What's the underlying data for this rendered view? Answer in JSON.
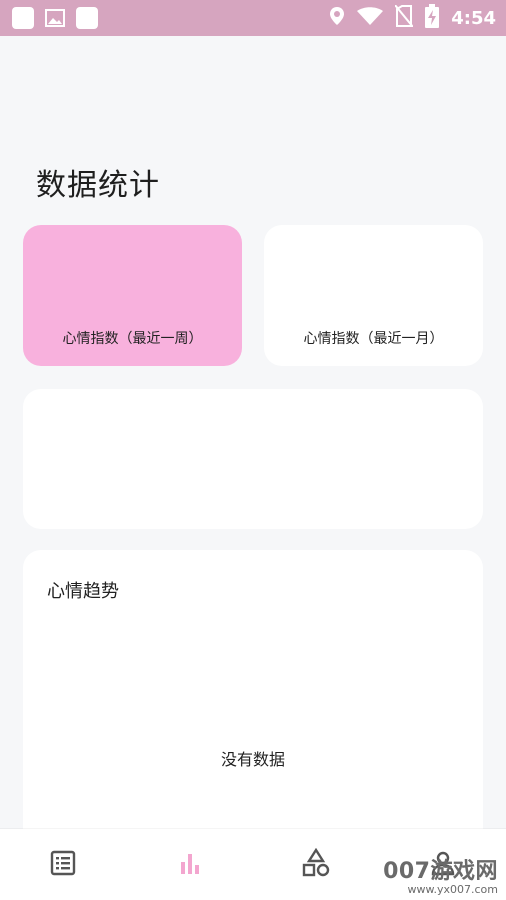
{
  "status_bar": {
    "time": "4:54",
    "icons_left": [
      "app-square-icon",
      "image-icon",
      "app-square-icon"
    ],
    "icons_right": [
      "location-icon",
      "wifi-icon",
      "no-sim-icon",
      "battery-charging-icon"
    ]
  },
  "page": {
    "title": "数据统计"
  },
  "cards": {
    "week_label": "心情指数（最近一周）",
    "month_label": "心情指数（最近一月）"
  },
  "trend": {
    "title": "心情趋势",
    "empty": "没有数据"
  },
  "nav": {
    "items": [
      "list-icon",
      "bar-chart-icon",
      "shapes-icon",
      "profile-icon"
    ],
    "active_color": "#f3a6cf"
  },
  "watermark": {
    "main": "007游戏网",
    "url": "www.yx007.com"
  },
  "colors": {
    "status_bar": "#d6a5bf",
    "pink_card": "#f8b1dd",
    "background": "#f6f7f9"
  }
}
